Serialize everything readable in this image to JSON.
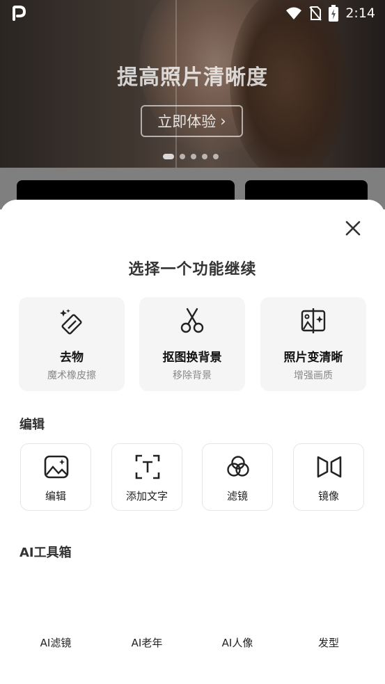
{
  "status_bar": {
    "time": "2:14"
  },
  "banner": {
    "title": "提高照片清晰度",
    "cta_label": "立即体验",
    "cta_arrow": "›",
    "dots": [
      true,
      false,
      false,
      false,
      false
    ]
  },
  "sheet": {
    "title": "选择一个功能继续",
    "features": [
      {
        "name": "去物",
        "sub": "魔术橡皮擦",
        "icon": "magic-eraser-icon"
      },
      {
        "name": "抠图换背景",
        "sub": "移除背景",
        "icon": "scissors-icon"
      },
      {
        "name": "照片变清晰",
        "sub": "增强画质",
        "icon": "enhance-photo-icon"
      }
    ],
    "edit_section": {
      "label": "编辑",
      "tools": [
        {
          "name": "编辑",
          "icon": "image-edit-icon"
        },
        {
          "name": "添加文字",
          "icon": "add-text-icon"
        },
        {
          "name": "滤镜",
          "icon": "filter-icon"
        },
        {
          "name": "镜像",
          "icon": "mirror-icon"
        }
      ]
    },
    "ai_section": {
      "label": "AI工具箱",
      "tools": [
        {
          "name": "AI滤镜"
        },
        {
          "name": "AI老年"
        },
        {
          "name": "AI人像"
        },
        {
          "name": "发型"
        }
      ]
    }
  }
}
